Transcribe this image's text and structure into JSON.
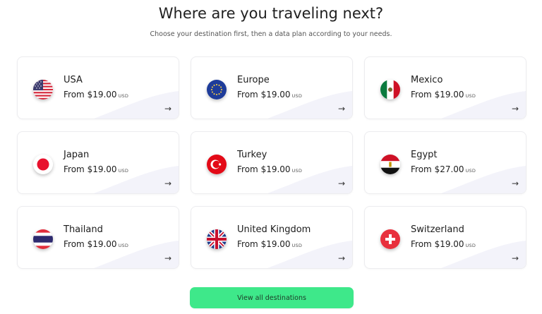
{
  "header": {
    "title": "Where are you traveling next?",
    "subtitle": "Choose your destination first, then a data plan according to your needs."
  },
  "destinations": [
    {
      "name": "USA",
      "price_prefix": "From",
      "price": "$19.00",
      "currency": "USD",
      "flag_icon": "usa-flag-icon"
    },
    {
      "name": "Europe",
      "price_prefix": "From",
      "price": "$19.00",
      "currency": "USD",
      "flag_icon": "eu-flag-icon"
    },
    {
      "name": "Mexico",
      "price_prefix": "From",
      "price": "$19.00",
      "currency": "USD",
      "flag_icon": "mexico-flag-icon"
    },
    {
      "name": "Japan",
      "price_prefix": "From",
      "price": "$19.00",
      "currency": "USD",
      "flag_icon": "japan-flag-icon"
    },
    {
      "name": "Turkey",
      "price_prefix": "From",
      "price": "$19.00",
      "currency": "USD",
      "flag_icon": "turkey-flag-icon"
    },
    {
      "name": "Egypt",
      "price_prefix": "From",
      "price": "$27.00",
      "currency": "USD",
      "flag_icon": "egypt-flag-icon"
    },
    {
      "name": "Thailand",
      "price_prefix": "From",
      "price": "$19.00",
      "currency": "USD",
      "flag_icon": "thailand-flag-icon"
    },
    {
      "name": "United Kingdom",
      "price_prefix": "From",
      "price": "$19.00",
      "currency": "USD",
      "flag_icon": "uk-flag-icon"
    },
    {
      "name": "Switzerland",
      "price_prefix": "From",
      "price": "$19.00",
      "currency": "USD",
      "flag_icon": "switzerland-flag-icon"
    }
  ],
  "card_arrow": "→",
  "cta": {
    "label": "View all destinations"
  },
  "colors": {
    "accent": "#3EE88A",
    "card_border": "#ECECEF"
  }
}
